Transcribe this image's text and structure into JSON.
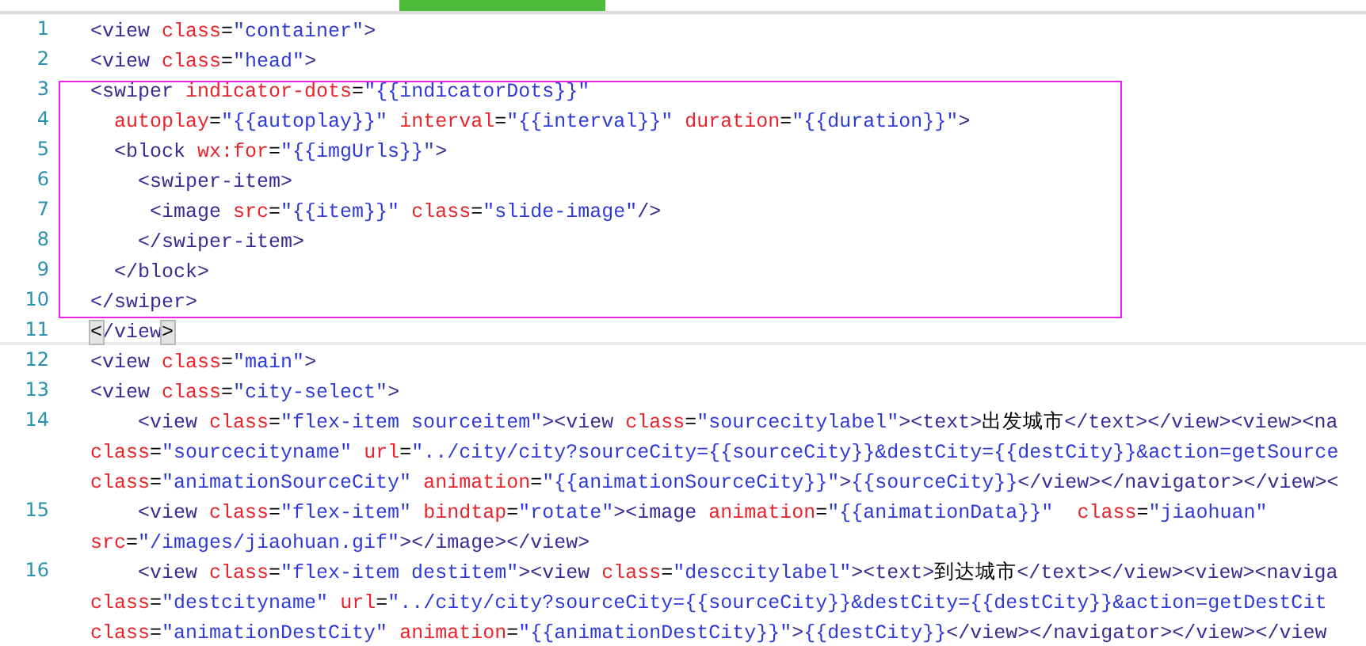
{
  "editor": {
    "lines": [
      {
        "number": "1",
        "current": false,
        "rows": [
          {
            "tokens": [
              {
                "kind": "tag",
                "text": "<view"
              },
              {
                "kind": "attr",
                "text": " class"
              },
              {
                "kind": "plain",
                "text": "="
              },
              {
                "kind": "str",
                "text": "\"container\""
              },
              {
                "kind": "tag",
                "text": ">"
              }
            ]
          }
        ]
      },
      {
        "number": "2",
        "current": false,
        "rows": [
          {
            "tokens": [
              {
                "kind": "tag",
                "text": "<view"
              },
              {
                "kind": "attr",
                "text": " class"
              },
              {
                "kind": "plain",
                "text": "="
              },
              {
                "kind": "str",
                "text": "\"head\""
              },
              {
                "kind": "tag",
                "text": ">"
              }
            ]
          }
        ]
      },
      {
        "number": "3",
        "current": false,
        "rows": [
          {
            "tokens": [
              {
                "kind": "tag",
                "text": "<swiper"
              },
              {
                "kind": "attr",
                "text": " indicator-dots"
              },
              {
                "kind": "plain",
                "text": "="
              },
              {
                "kind": "str",
                "text": "\"{{indicatorDots}}\""
              }
            ]
          }
        ]
      },
      {
        "number": "4",
        "current": false,
        "rows": [
          {
            "tokens": [
              {
                "kind": "attr",
                "text": "  autoplay"
              },
              {
                "kind": "plain",
                "text": "="
              },
              {
                "kind": "str",
                "text": "\"{{autoplay}}\""
              },
              {
                "kind": "attr",
                "text": " interval"
              },
              {
                "kind": "plain",
                "text": "="
              },
              {
                "kind": "str",
                "text": "\"{{interval}}\""
              },
              {
                "kind": "attr",
                "text": " duration"
              },
              {
                "kind": "plain",
                "text": "="
              },
              {
                "kind": "str",
                "text": "\"{{duration}}\""
              },
              {
                "kind": "tag",
                "text": ">"
              }
            ]
          }
        ]
      },
      {
        "number": "5",
        "current": false,
        "rows": [
          {
            "tokens": [
              {
                "kind": "tag",
                "text": "  <block"
              },
              {
                "kind": "attr",
                "text": " wx:for"
              },
              {
                "kind": "plain",
                "text": "="
              },
              {
                "kind": "str",
                "text": "\"{{imgUrls}}\""
              },
              {
                "kind": "tag",
                "text": ">"
              }
            ]
          }
        ]
      },
      {
        "number": "6",
        "current": false,
        "rows": [
          {
            "tokens": [
              {
                "kind": "tag",
                "text": "    <swiper-item>"
              }
            ]
          }
        ]
      },
      {
        "number": "7",
        "current": false,
        "rows": [
          {
            "tokens": [
              {
                "kind": "tag",
                "text": "     <image"
              },
              {
                "kind": "attr",
                "text": " src"
              },
              {
                "kind": "plain",
                "text": "="
              },
              {
                "kind": "str",
                "text": "\"{{item}}\""
              },
              {
                "kind": "attr",
                "text": " class"
              },
              {
                "kind": "plain",
                "text": "="
              },
              {
                "kind": "str",
                "text": "\"slide-image\""
              },
              {
                "kind": "tag",
                "text": "/>"
              }
            ]
          }
        ]
      },
      {
        "number": "8",
        "current": false,
        "rows": [
          {
            "tokens": [
              {
                "kind": "tag",
                "text": "    </swiper-item>"
              }
            ]
          }
        ]
      },
      {
        "number": "9",
        "current": false,
        "rows": [
          {
            "tokens": [
              {
                "kind": "tag",
                "text": "  </block>"
              }
            ]
          }
        ]
      },
      {
        "number": "10",
        "current": false,
        "rows": [
          {
            "tokens": [
              {
                "kind": "tag",
                "text": "</swiper>"
              }
            ]
          }
        ]
      },
      {
        "number": "11",
        "current": true,
        "rows": [
          {
            "tokens": [
              {
                "kind": "match",
                "text": "<"
              },
              {
                "kind": "tag",
                "text": "/view"
              },
              {
                "kind": "match",
                "text": ">"
              }
            ]
          }
        ]
      },
      {
        "number": "12",
        "current": false,
        "rows": [
          {
            "tokens": [
              {
                "kind": "tag",
                "text": "<view"
              },
              {
                "kind": "attr",
                "text": " class"
              },
              {
                "kind": "plain",
                "text": "="
              },
              {
                "kind": "str",
                "text": "\"main\""
              },
              {
                "kind": "tag",
                "text": ">"
              }
            ]
          }
        ]
      },
      {
        "number": "13",
        "current": false,
        "rows": [
          {
            "tokens": [
              {
                "kind": "tag",
                "text": "<view"
              },
              {
                "kind": "attr",
                "text": " class"
              },
              {
                "kind": "plain",
                "text": "="
              },
              {
                "kind": "str",
                "text": "\"city-select\""
              },
              {
                "kind": "tag",
                "text": ">"
              }
            ]
          }
        ]
      },
      {
        "number": "14",
        "current": false,
        "rows": [
          {
            "tokens": [
              {
                "kind": "tag",
                "text": "    <view"
              },
              {
                "kind": "attr",
                "text": " class"
              },
              {
                "kind": "plain",
                "text": "="
              },
              {
                "kind": "str",
                "text": "\"flex-item sourceitem\""
              },
              {
                "kind": "tag",
                "text": "><view"
              },
              {
                "kind": "attr",
                "text": " class"
              },
              {
                "kind": "plain",
                "text": "="
              },
              {
                "kind": "str",
                "text": "\"sourcecitylabel\""
              },
              {
                "kind": "tag",
                "text": "><text>"
              },
              {
                "kind": "plain",
                "text": "出发城市"
              },
              {
                "kind": "tag",
                "text": "</text></view><view><na"
              }
            ]
          },
          {
            "tokens": [
              {
                "kind": "attr",
                "text": "class"
              },
              {
                "kind": "plain",
                "text": "="
              },
              {
                "kind": "str",
                "text": "\"sourcecityname\""
              },
              {
                "kind": "attr",
                "text": " url"
              },
              {
                "kind": "plain",
                "text": "="
              },
              {
                "kind": "str",
                "text": "\"../city/city?sourceCity={{sourceCity}}&destCity={{destCity}}&action=getSource"
              }
            ]
          },
          {
            "tokens": [
              {
                "kind": "attr",
                "text": "class"
              },
              {
                "kind": "plain",
                "text": "="
              },
              {
                "kind": "str",
                "text": "\"animationSourceCity\""
              },
              {
                "kind": "attr",
                "text": " animation"
              },
              {
                "kind": "plain",
                "text": "="
              },
              {
                "kind": "str",
                "text": "\"{{animationSourceCity}}\""
              },
              {
                "kind": "tag",
                "text": ">"
              },
              {
                "kind": "str",
                "text": "{{sourceCity}}"
              },
              {
                "kind": "tag",
                "text": "</view></navigator></view><"
              }
            ]
          }
        ]
      },
      {
        "number": "15",
        "current": false,
        "rows": [
          {
            "tokens": [
              {
                "kind": "tag",
                "text": "    <view"
              },
              {
                "kind": "attr",
                "text": " class"
              },
              {
                "kind": "plain",
                "text": "="
              },
              {
                "kind": "str",
                "text": "\"flex-item\""
              },
              {
                "kind": "attr",
                "text": " bindtap"
              },
              {
                "kind": "plain",
                "text": "="
              },
              {
                "kind": "str",
                "text": "\"rotate\""
              },
              {
                "kind": "tag",
                "text": "><image"
              },
              {
                "kind": "attr",
                "text": " animation"
              },
              {
                "kind": "plain",
                "text": "="
              },
              {
                "kind": "str",
                "text": "\"{{animationData}}\""
              },
              {
                "kind": "attr",
                "text": "  class"
              },
              {
                "kind": "plain",
                "text": "="
              },
              {
                "kind": "str",
                "text": "\"jiaohuan\""
              }
            ]
          },
          {
            "tokens": [
              {
                "kind": "attr",
                "text": "src"
              },
              {
                "kind": "plain",
                "text": "="
              },
              {
                "kind": "str",
                "text": "\"/images/jiaohuan.gif\""
              },
              {
                "kind": "tag",
                "text": "></image></view>"
              }
            ]
          }
        ]
      },
      {
        "number": "16",
        "current": false,
        "rows": [
          {
            "tokens": [
              {
                "kind": "tag",
                "text": "    <view"
              },
              {
                "kind": "attr",
                "text": " class"
              },
              {
                "kind": "plain",
                "text": "="
              },
              {
                "kind": "str",
                "text": "\"flex-item destitem\""
              },
              {
                "kind": "tag",
                "text": "><view"
              },
              {
                "kind": "attr",
                "text": " class"
              },
              {
                "kind": "plain",
                "text": "="
              },
              {
                "kind": "str",
                "text": "\"desccitylabel\""
              },
              {
                "kind": "tag",
                "text": "><text>"
              },
              {
                "kind": "plain",
                "text": "到达城市"
              },
              {
                "kind": "tag",
                "text": "</text></view><view><naviga"
              }
            ]
          },
          {
            "tokens": [
              {
                "kind": "attr",
                "text": "class"
              },
              {
                "kind": "plain",
                "text": "="
              },
              {
                "kind": "str",
                "text": "\"destcityname\""
              },
              {
                "kind": "attr",
                "text": " url"
              },
              {
                "kind": "plain",
                "text": "="
              },
              {
                "kind": "str",
                "text": "\"../city/city?sourceCity={{sourceCity}}&destCity={{destCity}}&action=getDestCit"
              }
            ]
          },
          {
            "tokens": [
              {
                "kind": "attr",
                "text": "class"
              },
              {
                "kind": "plain",
                "text": "="
              },
              {
                "kind": "str",
                "text": "\"animationDestCity\""
              },
              {
                "kind": "attr",
                "text": " animation"
              },
              {
                "kind": "plain",
                "text": "="
              },
              {
                "kind": "str",
                "text": "\"{{animationDestCity}}\""
              },
              {
                "kind": "tag",
                "text": ">"
              },
              {
                "kind": "str",
                "text": "{{destCity}}"
              },
              {
                "kind": "tag",
                "text": "</view></navigator></view></view"
              }
            ]
          }
        ]
      }
    ]
  }
}
